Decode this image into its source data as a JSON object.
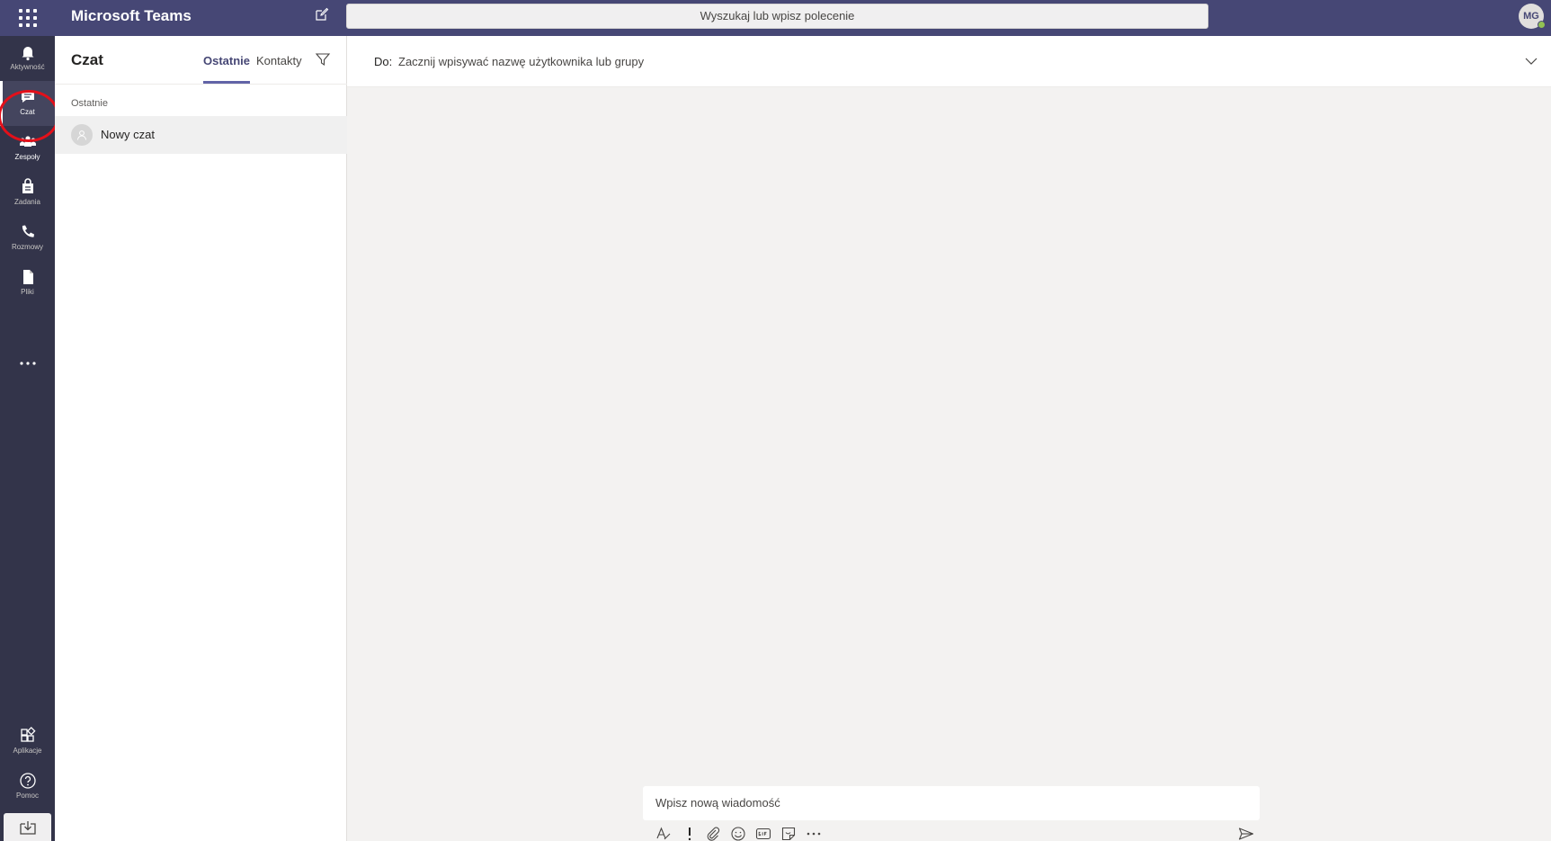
{
  "app": {
    "title": "Microsoft Teams"
  },
  "search": {
    "placeholder": "Wyszukaj lub wpisz polecenie"
  },
  "user": {
    "initials": "MG"
  },
  "rail": {
    "items": [
      {
        "label": "Aktywność",
        "icon": "bell-icon"
      },
      {
        "label": "Czat",
        "icon": "chat-icon"
      },
      {
        "label": "Zespoły",
        "icon": "teams-icon"
      },
      {
        "label": "Zadania",
        "icon": "assignments-icon"
      },
      {
        "label": "Rozmowy",
        "icon": "phone-icon"
      },
      {
        "label": "Pliki",
        "icon": "file-icon"
      }
    ],
    "bottom": [
      {
        "label": "Aplikacje",
        "icon": "apps-icon"
      },
      {
        "label": "Pomoc",
        "icon": "help-icon"
      }
    ]
  },
  "chat_pane": {
    "title": "Czat",
    "tabs": [
      "Ostatnie",
      "Kontakty"
    ],
    "section_label": "Ostatnie",
    "chats": [
      {
        "name": "Nowy czat"
      }
    ]
  },
  "main": {
    "to_label": "Do:",
    "to_placeholder": "Zacznij wpisywać nazwę użytkownika lub grupy",
    "message_placeholder": "Wpisz nową wiadomość"
  },
  "colors": {
    "header": "#464775",
    "rail": "#33344a",
    "accent": "#6264a7",
    "highlight": "#e3101a"
  }
}
